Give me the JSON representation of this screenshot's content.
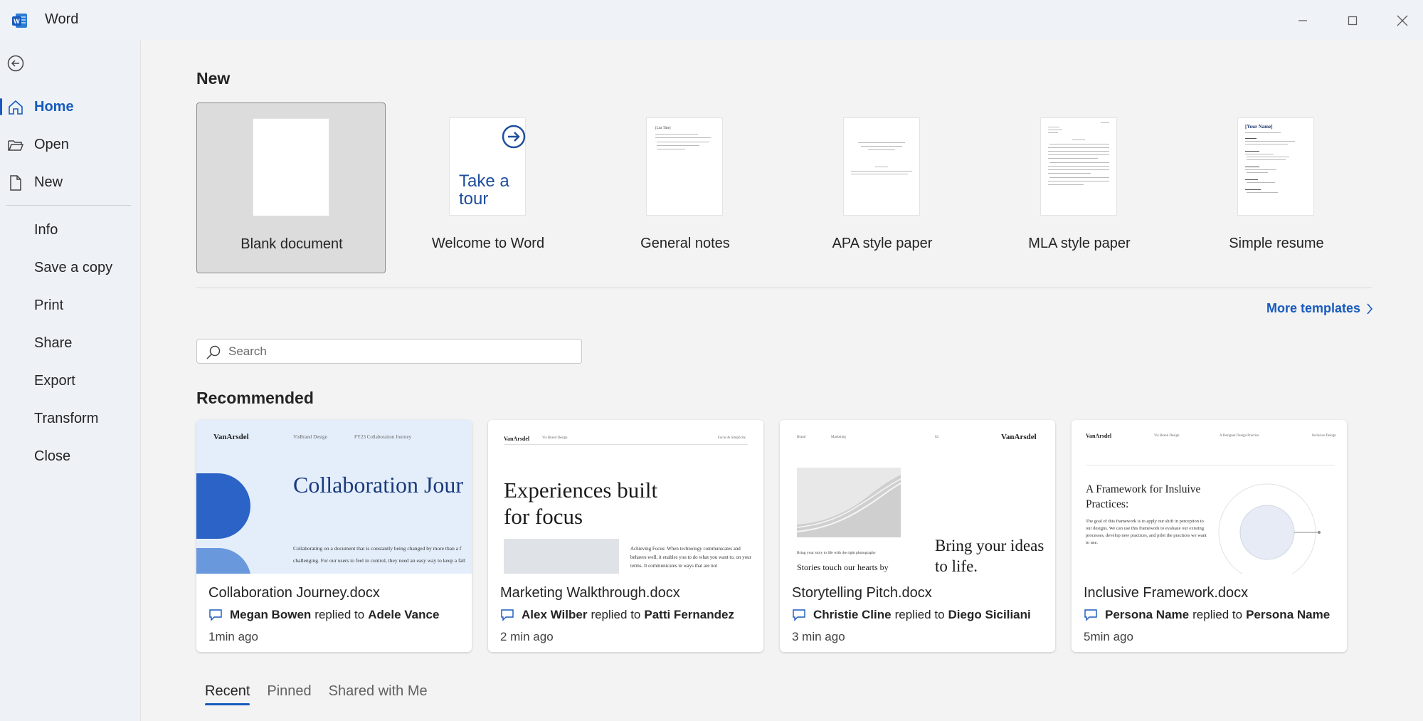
{
  "app": {
    "title": "Word",
    "logo_letter": "W"
  },
  "window_controls": {
    "minimize": "minimize-icon",
    "maximize": "maximize-icon",
    "close": "close-icon"
  },
  "sidebar": {
    "back_icon": "back-arrow-icon",
    "primary": [
      {
        "label": "Home",
        "icon": "home-icon",
        "active": true
      },
      {
        "label": "Open",
        "icon": "folder-open-icon",
        "active": false
      },
      {
        "label": "New",
        "icon": "new-document-icon",
        "active": false
      }
    ],
    "secondary": [
      "Info",
      "Save a copy",
      "Print",
      "Share",
      "Export",
      "Transform",
      "Close"
    ]
  },
  "new_section": {
    "title": "New",
    "templates": [
      {
        "label": "Blank document"
      },
      {
        "label": "Welcome to Word",
        "thumb_text": "Take a tour"
      },
      {
        "label": "General notes",
        "thumb_text": "[List Title]"
      },
      {
        "label": "APA style paper"
      },
      {
        "label": "MLA style paper"
      },
      {
        "label": "Simple resume",
        "thumb_text": "[Your Name]"
      }
    ],
    "more_templates": "More templates"
  },
  "search": {
    "placeholder": "Search"
  },
  "recommended": {
    "title": "Recommended",
    "cards": [
      {
        "file": "Collaboration Journey.docx",
        "user": "Megan Bowen",
        "action": "replied to",
        "target": "Adele Vance",
        "time": "1min ago",
        "preview": {
          "brand": "VanArsdel",
          "nav": [
            "VisBrand Design",
            "FY23 Collaboration Journey"
          ],
          "headline": "Collaboration Jour",
          "body": "Collaborating on a document that is constantly being changed by more than a f challenging. For our users to feel in control, they need an easy way to keep a fall"
        }
      },
      {
        "file": "Marketing Walkthrough.docx",
        "user": "Alex Wilber",
        "action": "replied to",
        "target": "Patti Fernandez",
        "time": "2 min ago",
        "preview": {
          "brand": "VanArsdel",
          "nav": [
            "Vis Brand Design",
            "Focus & Simplicity"
          ],
          "headline": "Experiences built for focus",
          "body": "Achieving Focus: When technology communicates and behaves well, it enables you to do what you want to, on your terms. It communicates in ways that are not"
        }
      },
      {
        "file": "Storytelling Pitch.docx",
        "user": "Christie Cline",
        "action": "replied to",
        "target": "Diego Siciliani",
        "time": "3 min ago",
        "preview": {
          "brand": "VanArsdel",
          "nav": [
            "Brand",
            "Marketing",
            "02"
          ],
          "caption": "Bring your story to life with the right photography",
          "left_headline": "Stories touch our hearts by",
          "headline": "Bring your ideas to life."
        }
      },
      {
        "file": "Inclusive Framework.docx",
        "user": "Persona Name",
        "action": "replied to",
        "target": "Persona Name",
        "time": "5min ago",
        "preview": {
          "brand": "VanArsdel",
          "nav": [
            "Vis Brand Design",
            "A Designer Design Practice",
            "Inclusive Design"
          ],
          "headline": "A Framework for Insluive Practices:",
          "body": "The goal of this framework is to apply our shift in perception to our designs. We can use this framework to evaluate our existing processes, develop new practices, and pilot the practices we want to use."
        }
      }
    ]
  },
  "tabs": [
    {
      "label": "Recent",
      "active": true
    },
    {
      "label": "Pinned",
      "active": false
    },
    {
      "label": "Shared with Me",
      "active": false
    }
  ],
  "colors": {
    "accent": "#185abd",
    "sidebar_bg": "#eef2f7",
    "main_bg": "#f3f3f3"
  }
}
